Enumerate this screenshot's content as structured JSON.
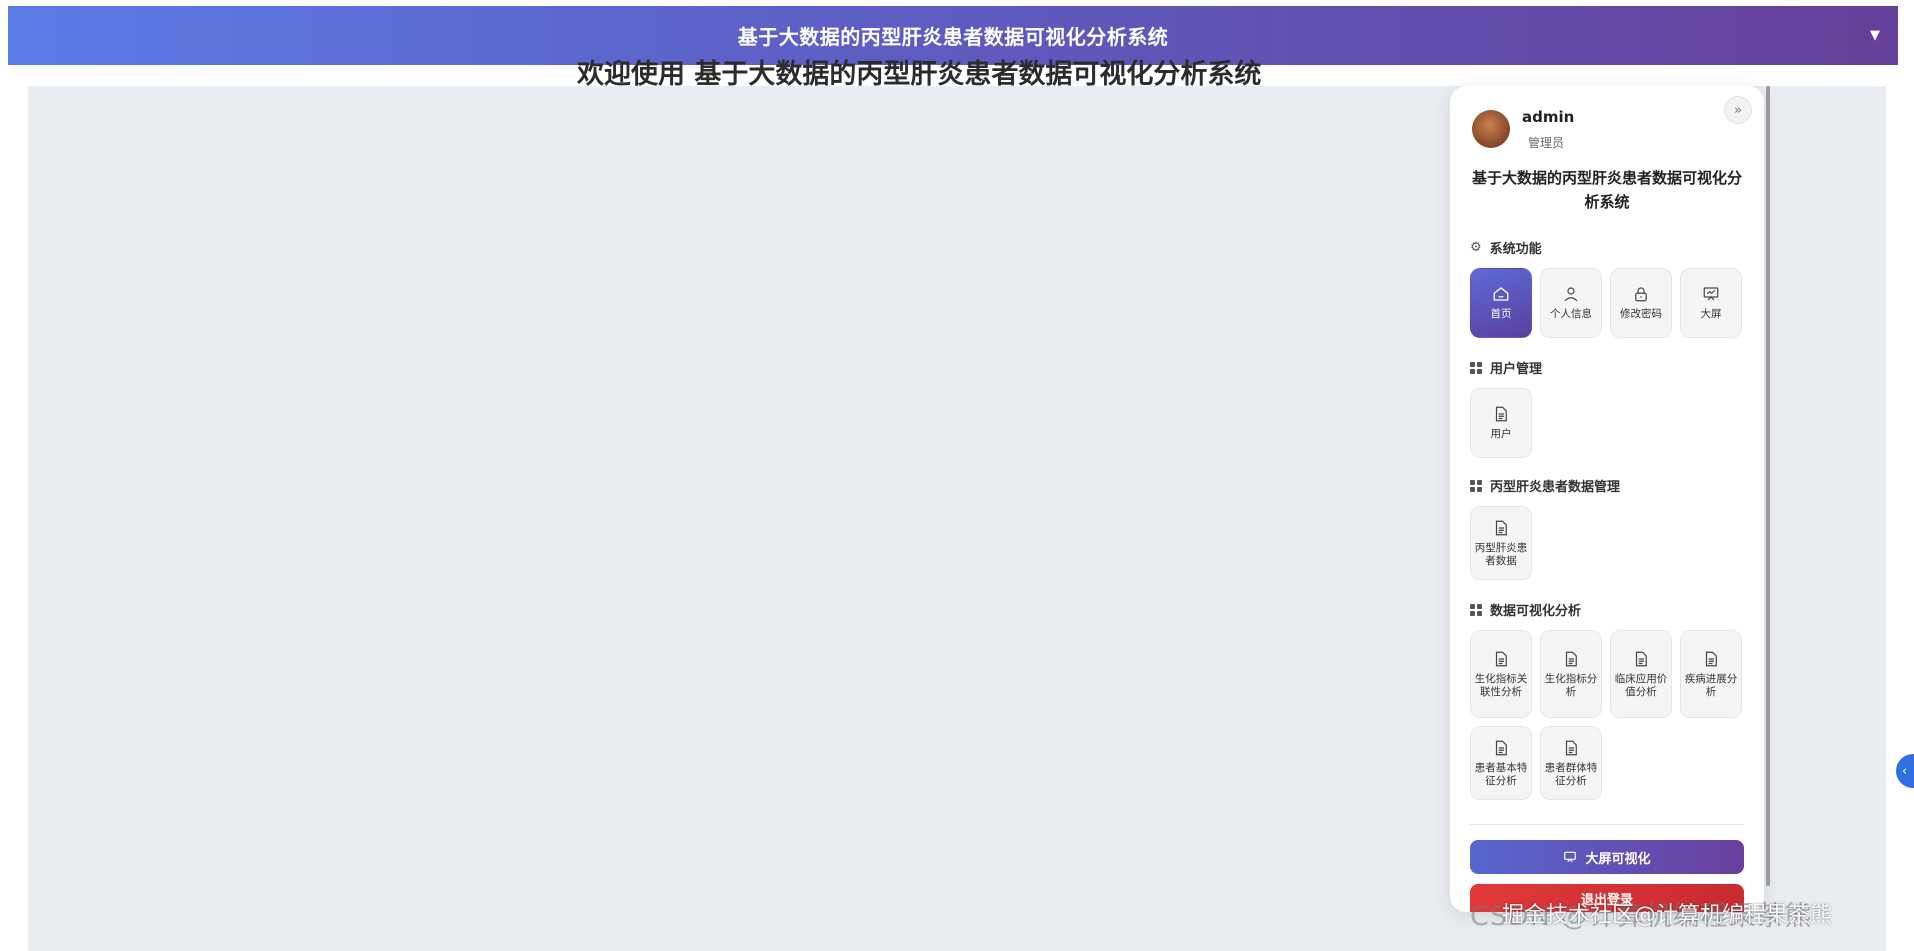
{
  "header": {
    "title": "基于大数据的丙型肝炎患者数据可视化分析系统",
    "caret": "▼"
  },
  "main": {
    "welcome": "欢迎使用 基于大数据的丙型肝炎患者数据可视化分析系统"
  },
  "panel": {
    "user": {
      "name": "admin",
      "role": "管理员"
    },
    "collapse_glyph": "»",
    "system_title": "基于大数据的丙型肝炎患者数据可视化分析系统",
    "sections": [
      {
        "title": "系统功能",
        "icon": "gear-icon",
        "items": [
          {
            "label": "首页",
            "icon": "home-icon",
            "active": true
          },
          {
            "label": "个人信息",
            "icon": "user-icon"
          },
          {
            "label": "修改密码",
            "icon": "lock-icon"
          },
          {
            "label": "大屏",
            "icon": "screen-icon"
          }
        ]
      },
      {
        "title": "用户管理",
        "icon": "grid-icon",
        "items": [
          {
            "label": "用户",
            "icon": "document-icon"
          }
        ]
      },
      {
        "title": "丙型肝炎患者数据管理",
        "icon": "grid-icon",
        "items": [
          {
            "label": "丙型肝炎患者数据",
            "icon": "document-icon"
          }
        ]
      },
      {
        "title": "数据可视化分析",
        "icon": "grid-icon",
        "items": [
          {
            "label": "生化指标关联性分析",
            "icon": "document-icon"
          },
          {
            "label": "生化指标分析",
            "icon": "document-icon"
          },
          {
            "label": "临床应用价值分析",
            "icon": "document-icon"
          },
          {
            "label": "疾病进展分析",
            "icon": "document-icon"
          },
          {
            "label": "患者基本特征分析",
            "icon": "document-icon"
          },
          {
            "label": "患者群体特征分析",
            "icon": "document-icon"
          }
        ]
      }
    ],
    "screen_button": "大屏可视化",
    "logout_button": "退出登录"
  },
  "watermark": "CSDN @计算机编程果茶熊",
  "watermark_overlay": "掘金技术社区@计算机编程果茶熊",
  "colors": {
    "header_start": "#5b7be6",
    "header_end": "#66409a",
    "logout": "#e0393b",
    "accent": "#5a3f9f"
  }
}
